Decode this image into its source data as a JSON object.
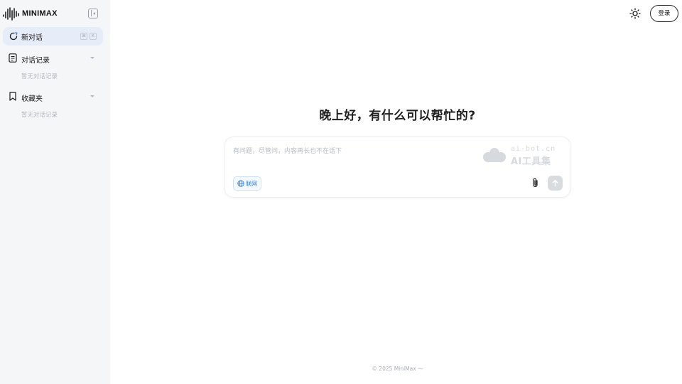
{
  "brand": {
    "name": "MINIMAX"
  },
  "sidebar": {
    "new_chat_label": "新对话",
    "shortcut_keys": [
      "⌘",
      "K"
    ],
    "history": {
      "label": "对话记录",
      "empty": "暂无对话记录"
    },
    "favorites": {
      "label": "收藏夹",
      "empty": "暂无对话记录"
    }
  },
  "header": {
    "login_label": "登录",
    "theme_icon": "sun-icon"
  },
  "main": {
    "greeting": "晚上好，有什么可以帮忙的?",
    "composer": {
      "placeholder": "有问题，尽管问，内容再长也不在话下",
      "web_search_label": "联网"
    }
  },
  "watermark": {
    "url": "ai-bot.cn",
    "title": "AI工具集"
  },
  "footer": {
    "text": "© 2025 MiniMax —"
  },
  "colors": {
    "sidebar_bg": "#f5f6f8",
    "active_item_bg": "#e6edf8",
    "accent": "#3c7fd0"
  }
}
